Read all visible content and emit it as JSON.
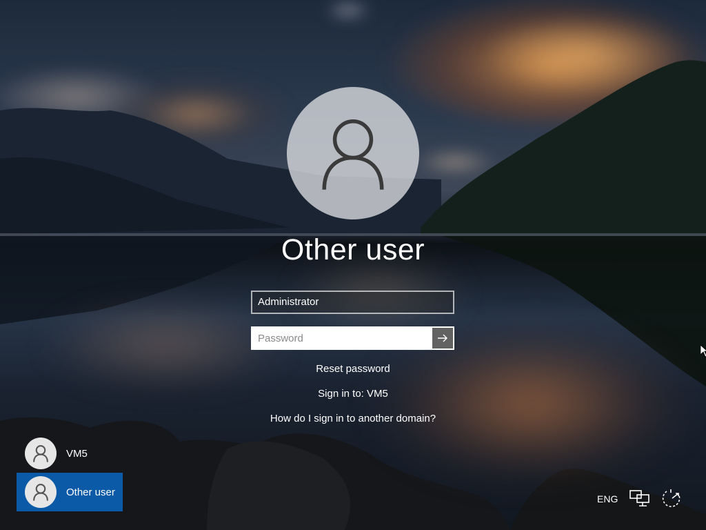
{
  "user": {
    "display_name": "Other user"
  },
  "form": {
    "username_value": "Administrator",
    "password_placeholder": "Password"
  },
  "links": {
    "reset_password": "Reset password",
    "sign_in_to": "Sign in to: VM5",
    "other_domain": "How do I sign in to another domain?"
  },
  "user_list": [
    {
      "label": "VM5",
      "selected": false
    },
    {
      "label": "Other user",
      "selected": true
    }
  ],
  "tray": {
    "language": "ENG",
    "icons": [
      "network-icon",
      "ease-of-access-icon",
      "power-icon"
    ]
  },
  "colors": {
    "selected_tile": "#0b5aa8"
  }
}
